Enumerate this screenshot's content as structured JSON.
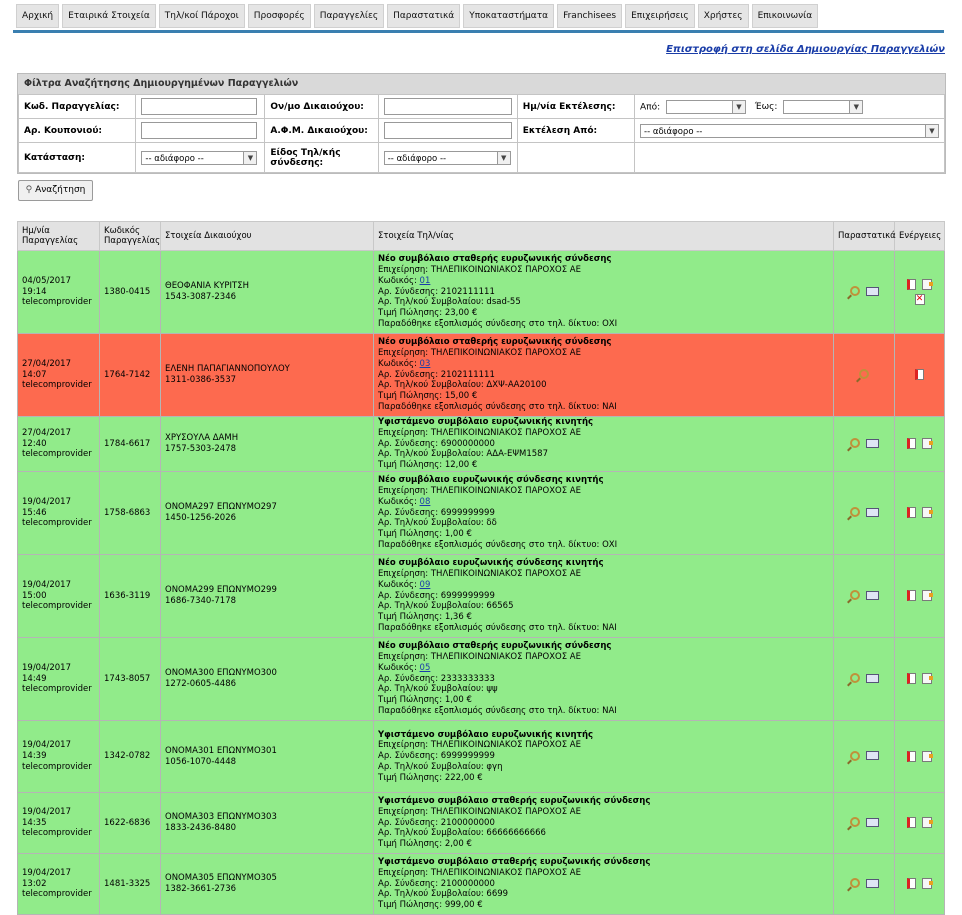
{
  "nav": [
    "Αρχική",
    "Εταιρικά Στοιχεία",
    "Τηλ/κοί Πάροχοι",
    "Προσφορές",
    "Παραγγελίες",
    "Παραστατικά",
    "Υποκαταστήματα",
    "Franchisees",
    "Επιχειρήσεις",
    "Χρήστες",
    "Επικοινωνία"
  ],
  "back_link": "Επιστροφή στη σελίδα Δημιουργίας Παραγγελιών",
  "filters": {
    "title": "Φίλτρα Αναζήτησης Δημιουργημένων Παραγγελιών",
    "order_code": "Κωδ. Παραγγελίας:",
    "holder_name": "Ον/μο Δικαιούχου:",
    "exec_date": "Ημ/νία Εκτέλεσης:",
    "from": "Από:",
    "to": "Έως:",
    "coupon": "Αρ. Κουπονιού:",
    "afm": "Α.Φ.Μ. Δικαιούχου:",
    "exec_from": "Εκτέλεση Από:",
    "status": "Κατάσταση:",
    "conn_type": "Είδος Τηλ/κής σύνδεσης:",
    "any": "-- αδιάφορο --",
    "search_button": "Αναζήτηση"
  },
  "columns": [
    "Ημ/νία Παραγγελίας",
    "Κωδικός Παραγγελίας",
    "Στοιχεία Δικαιούχου",
    "Στοιχεία Τηλ/νίας",
    "Παραστατικά",
    "Ενέργειες"
  ],
  "rows": [
    {
      "color": "green",
      "date": "04/05/2017 19:14",
      "user": "telecomprovider",
      "code": "1380-0415",
      "name": "ΘΕΟΦΑΝΙΑ ΚΥΡΙΤΣΗ",
      "phone": "1543-3087-2346",
      "title": "Νέο συμβόλαιο σταθερής ευρυζωνικής σύνδεσης",
      "company": "Επιχείρηση: ΤΗΛΕΠΙΚΟΙΝΩΝΙΑΚΟΣ ΠΑΡΟΧΟΣ ΑΕ",
      "code_label": "Κωδικός: ",
      "code_link": "01",
      "conn": "Αρ. Σύνδεσης: 2102111111",
      "contract": "Αρ. Τηλ/κού Συμβολαίου: dsad-55",
      "price": "Τιμή Πώλησης: 23,00 €",
      "equip": "Παραδόθηκε εξοπλισμός σύνδεσης στο τηλ. δίκτυο: ΟΧΙ",
      "del": true
    },
    {
      "color": "red",
      "date": "27/04/2017 14:07",
      "user": "telecomprovider",
      "code": "1764-7142",
      "name": "ΕΛΕΝΗ ΠΑΠΑΓΙΑΝΝΟΠΟΥΛΟΥ",
      "phone": "1311-0386-3537",
      "title": "Νέο συμβόλαιο σταθερής ευρυζωνικής σύνδεσης",
      "company": "Επιχείρηση: ΤΗΛΕΠΙΚΟΙΝΩΝΙΑΚΟΣ ΠΑΡΟΧΟΣ ΑΕ",
      "code_label": "Κωδικός: ",
      "code_link": "03",
      "conn": "Αρ. Σύνδεσης: 2102111111",
      "contract": "Αρ. Τηλ/κού Συμβολαίου: ΔΧΨ-ΑΑ20100",
      "price": "Τιμή Πώλησης: 15,00 €",
      "equip": "Παραδόθηκε εξοπλισμός σύνδεσης στο τηλ. δίκτυο: ΝΑΙ",
      "red": true
    },
    {
      "color": "green",
      "date": "27/04/2017 12:40",
      "user": "telecomprovider",
      "code": "1784-6617",
      "name": "ΧΡΥΣΟΥΛΑ ΔΑΜΗ",
      "phone": "1757-5303-2478",
      "title": "Υφιστάμενο συμβόλαιο ευρυζωνικής κινητής",
      "company": "Επιχείρηση: ΤΗΛΕΠΙΚΟΙΝΩΝΙΑΚΟΣ ΠΑΡΟΧΟΣ ΑΕ",
      "conn": "Αρ. Σύνδεσης: 6900000000",
      "contract": "Αρ. Τηλ/κού Συμβολαίου: ΑΔΑ-ΕΨΜ1587",
      "price": "Τιμή Πώλησης: 12,00 €"
    },
    {
      "color": "green",
      "date": "19/04/2017 15:46",
      "user": "telecomprovider",
      "code": "1758-6863",
      "name": "ΟΝΟΜΑ297 ΕΠΩΝΥΜΟ297",
      "phone": "1450-1256-2026",
      "title": "Νέο συμβόλαιο ευρυζωνικής σύνδεσης κινητής",
      "company": "Επιχείρηση: ΤΗΛΕΠΙΚΟΙΝΩΝΙΑΚΟΣ ΠΑΡΟΧΟΣ ΑΕ",
      "code_label": "Κωδικός: ",
      "code_link": "08",
      "conn": "Αρ. Σύνδεσης: 6999999999",
      "contract": "Αρ. Τηλ/κού Συμβολαίου: δδ",
      "price": "Τιμή Πώλησης: 1,00 €",
      "equip": "Παραδόθηκε εξοπλισμός σύνδεσης στο τηλ. δίκτυο: ΟΧΙ"
    },
    {
      "color": "green",
      "date": "19/04/2017 15:00",
      "user": "telecomprovider",
      "code": "1636-3119",
      "name": "ΟΝΟΜΑ299 ΕΠΩΝΥΜΟ299",
      "phone": "1686-7340-7178",
      "title": "Νέο συμβόλαιο ευρυζωνικής σύνδεσης κινητής",
      "company": "Επιχείρηση: ΤΗΛΕΠΙΚΟΙΝΩΝΙΑΚΟΣ ΠΑΡΟΧΟΣ ΑΕ",
      "code_label": "Κωδικός: ",
      "code_link": "09",
      "conn": "Αρ. Σύνδεσης: 6999999999",
      "contract": "Αρ. Τηλ/κού Συμβολαίου: 66565",
      "price": "Τιμή Πώλησης: 1,36 €",
      "equip": "Παραδόθηκε εξοπλισμός σύνδεσης στο τηλ. δίκτυο: ΝΑΙ"
    },
    {
      "color": "green",
      "date": "19/04/2017 14:49",
      "user": "telecomprovider",
      "code": "1743-8057",
      "name": "ΟΝΟΜΑ300 ΕΠΩΝΥΜΟ300",
      "phone": "1272-0605-4486",
      "title": "Νέο συμβόλαιο σταθερής ευρυζωνικής σύνδεσης",
      "company": "Επιχείρηση: ΤΗΛΕΠΙΚΟΙΝΩΝΙΑΚΟΣ ΠΑΡΟΧΟΣ ΑΕ",
      "code_label": "Κωδικός: ",
      "code_link": "05",
      "conn": "Αρ. Σύνδεσης: 2333333333",
      "contract": "Αρ. Τηλ/κού Συμβολαίου: ψψ",
      "price": "Τιμή Πώλησης: 1,00 €",
      "equip": "Παραδόθηκε εξοπλισμός σύνδεσης στο τηλ. δίκτυο: ΝΑΙ"
    },
    {
      "color": "green",
      "date": "19/04/2017 14:39",
      "user": "telecomprovider",
      "code": "1342-0782",
      "name": "ΟΝΟΜΑ301 ΕΠΩΝΥΜΟ301",
      "phone": "1056-1070-4448",
      "title": "Υφιστάμενο συμβόλαιο ευρυζωνικής κινητής",
      "company": "Επιχείρηση: ΤΗΛΕΠΙΚΟΙΝΩΝΙΑΚΟΣ ΠΑΡΟΧΟΣ ΑΕ",
      "conn": "Αρ. Σύνδεσης: 6999999999",
      "contract": "Αρ. Τηλ/κού Συμβολαίου: φγη",
      "price": "Τιμή Πώλησης: 222,00 €"
    },
    {
      "color": "green",
      "date": "19/04/2017 14:35",
      "user": "telecomprovider",
      "code": "1622-6836",
      "name": "ΟΝΟΜΑ303 ΕΠΩΝΥΜΟ303",
      "phone": "1833-2436-8480",
      "title": "Υφιστάμενο συμβόλαιο σταθερής ευρυζωνικής σύνδεσης",
      "company": "Επιχείρηση: ΤΗΛΕΠΙΚΟΙΝΩΝΙΑΚΟΣ ΠΑΡΟΧΟΣ ΑΕ",
      "conn": "Αρ. Σύνδεσης: 2100000000",
      "contract": "Αρ. Τηλ/κού Συμβολαίου: 66666666666",
      "price": "Τιμή Πώλησης: 2,00 €"
    },
    {
      "color": "green",
      "date": "19/04/2017 13:02",
      "user": "telecomprovider",
      "code": "1481-3325",
      "name": "ΟΝΟΜΑ305 ΕΠΩΝΥΜΟ305",
      "phone": "1382-3661-2736",
      "title": "Υφιστάμενο συμβόλαιο σταθερής ευρυζωνικής σύνδεσης",
      "company": "Επιχείρηση: ΤΗΛΕΠΙΚΟΙΝΩΝΙΑΚΟΣ ΠΑΡΟΧΟΣ ΑΕ",
      "conn": "Αρ. Σύνδεσης: 2100000000",
      "contract": "Αρ. Τηλ/κού Συμβολαίου: 6699",
      "price": "Τιμή Πώλησης: 999,00 €"
    }
  ]
}
